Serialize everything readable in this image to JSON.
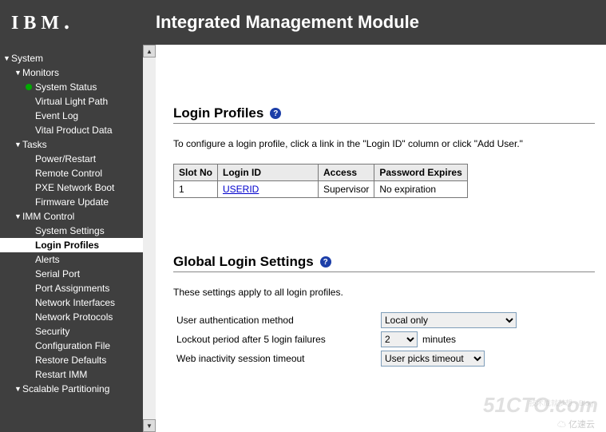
{
  "logo": "IBM",
  "title": "Integrated Management Module",
  "nav": {
    "system": "System",
    "monitors": "Monitors",
    "system_status": "System Status",
    "virtual_light_path": "Virtual Light Path",
    "event_log": "Event Log",
    "vital_product_data": "Vital Product Data",
    "tasks": "Tasks",
    "power_restart": "Power/Restart",
    "remote_control": "Remote Control",
    "pxe_network_boot": "PXE Network Boot",
    "firmware_update": "Firmware Update",
    "imm_control": "IMM Control",
    "system_settings": "System Settings",
    "login_profiles": "Login Profiles",
    "alerts": "Alerts",
    "serial_port": "Serial Port",
    "port_assignments": "Port Assignments",
    "network_interfaces": "Network Interfaces",
    "network_protocols": "Network Protocols",
    "security": "Security",
    "configuration_file": "Configuration File",
    "restore_defaults": "Restore Defaults",
    "restart_imm": "Restart IMM",
    "scalable_partitioning": "Scalable Partitioning"
  },
  "login_profiles": {
    "heading": "Login Profiles",
    "desc": "To configure a login profile, click a link in the \"Login ID\" column or click \"Add User.\"",
    "cols": {
      "slot": "Slot No",
      "login": "Login ID",
      "access": "Access",
      "expires": "Password Expires"
    },
    "rows": [
      {
        "slot": "1",
        "login": "USERID",
        "access": "Supervisor",
        "expires": "No expiration"
      }
    ]
  },
  "global": {
    "heading": "Global Login Settings",
    "desc": "These settings apply to all login profiles.",
    "auth_label": "User authentication method",
    "auth_value": "Local only",
    "lockout_label": "Lockout period after 5 login failures",
    "lockout_value": "2",
    "lockout_unit": "minutes",
    "web_timeout_label": "Web inactivity session timeout",
    "web_timeout_value": "User picks timeout"
  }
}
